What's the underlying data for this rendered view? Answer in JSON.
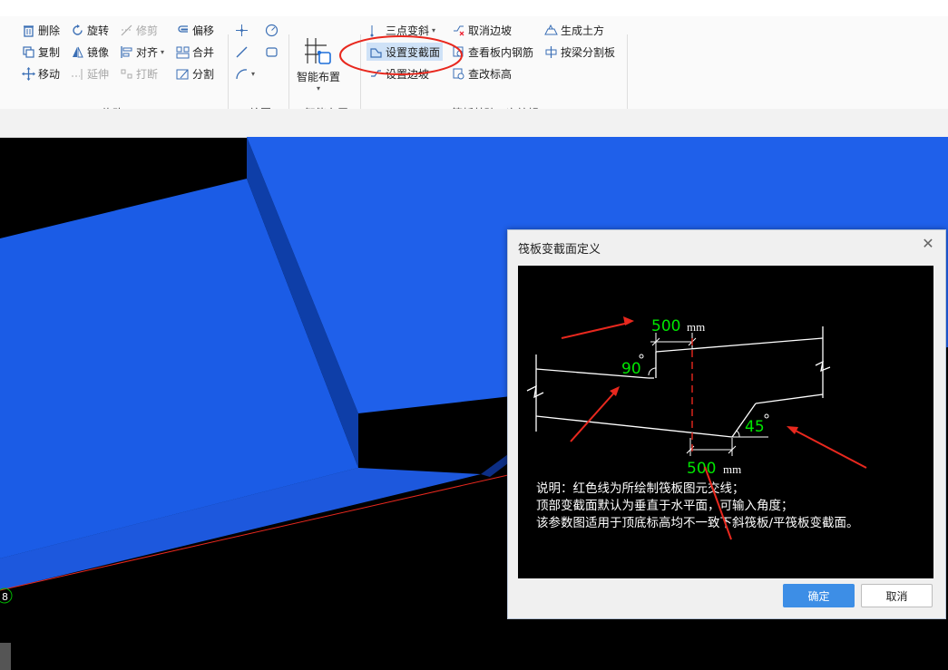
{
  "ribbon": {
    "modify": {
      "delete": "删除",
      "rotate": "旋转",
      "trim": "修剪",
      "offset": "偏移",
      "copy": "复制",
      "mirror": "镜像",
      "align": "对齐",
      "merge": "合并",
      "move": "移动",
      "extend": "延伸",
      "break": "打断",
      "split": "分割",
      "group_label": "修改"
    },
    "draw": {
      "group_label": "绘图"
    },
    "smart": {
      "button_label": "智能布置",
      "group_label": "智能布置"
    },
    "raft": {
      "three_point_slope": "三点变斜",
      "set_variable_section": "设置变截面",
      "set_slope_edge": "设置边坡",
      "cancel_slope_edge": "取消边坡",
      "view_rebar": "查看板内钢筋",
      "check_elevation": "查改标高",
      "generate_earthwork": "生成土方",
      "split_by_beam": "按梁分割板",
      "group_label": "筏板基础二次编辑"
    }
  },
  "canvas": {
    "axis_label": "8"
  },
  "dialog": {
    "title": "筏板变截面定义",
    "close_icon": "close-icon",
    "diagram": {
      "top_width": "500",
      "top_unit": "mm",
      "top_angle": "90",
      "bottom_angle": "45",
      "bottom_width": "500",
      "bottom_unit": "mm",
      "note1": "说明：红色线为所绘制筏板图元交线；",
      "note2": "顶部变截面默认为垂直于水平面，可输入角度；",
      "note3": "该参数图适用于顶底标高均不一致下斜筏板/平筏板变截面。"
    },
    "ok_label": "确定",
    "cancel_label": "取消"
  },
  "colors": {
    "slab_blue": "#1f5fe8",
    "annotation_red": "#e8281e",
    "dim_green": "#00e600",
    "ok_blue": "#3d8ee6"
  }
}
